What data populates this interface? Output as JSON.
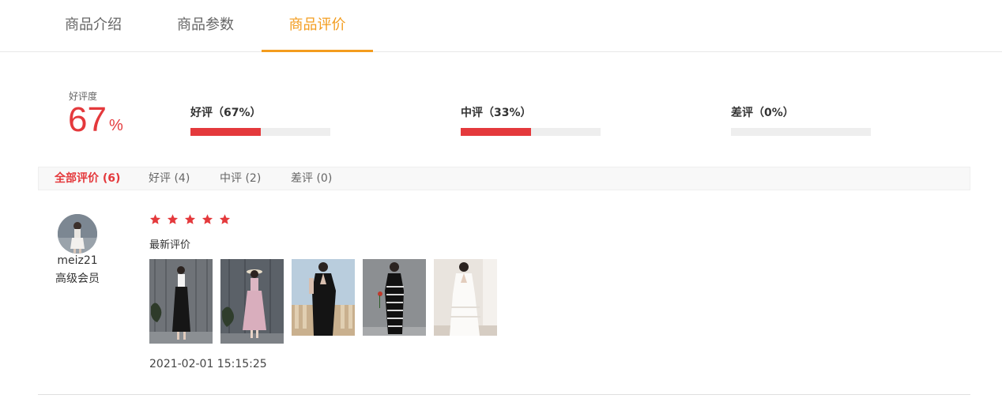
{
  "tabs": [
    "商品介绍",
    "商品参数",
    "商品评价"
  ],
  "active_tab": "商品评价",
  "summary": {
    "rate_label": "好评度",
    "rate_value": "67",
    "rate_unit": "%",
    "metrics": [
      {
        "label": "好评（67%）",
        "fraction": 0.5
      },
      {
        "label": "中评（33%）",
        "fraction": 0.5
      },
      {
        "label": "差评（0%）",
        "fraction": 0
      }
    ]
  },
  "filters": [
    "全部评价 (6)",
    "好评 (4)",
    "中评 (2)",
    "差评 (0)"
  ],
  "review": {
    "username": "meiz21",
    "level": "高级会员",
    "stars": 5,
    "content": "最新评价",
    "photo_count": 5,
    "time": "2021-02-01 15:15:25"
  },
  "colors": {
    "accent_tab": "#f39c1e",
    "rating_red": "#e4393c",
    "bar_bg": "#eeeeee"
  },
  "icons": [
    "star-icon",
    "avatar"
  ]
}
